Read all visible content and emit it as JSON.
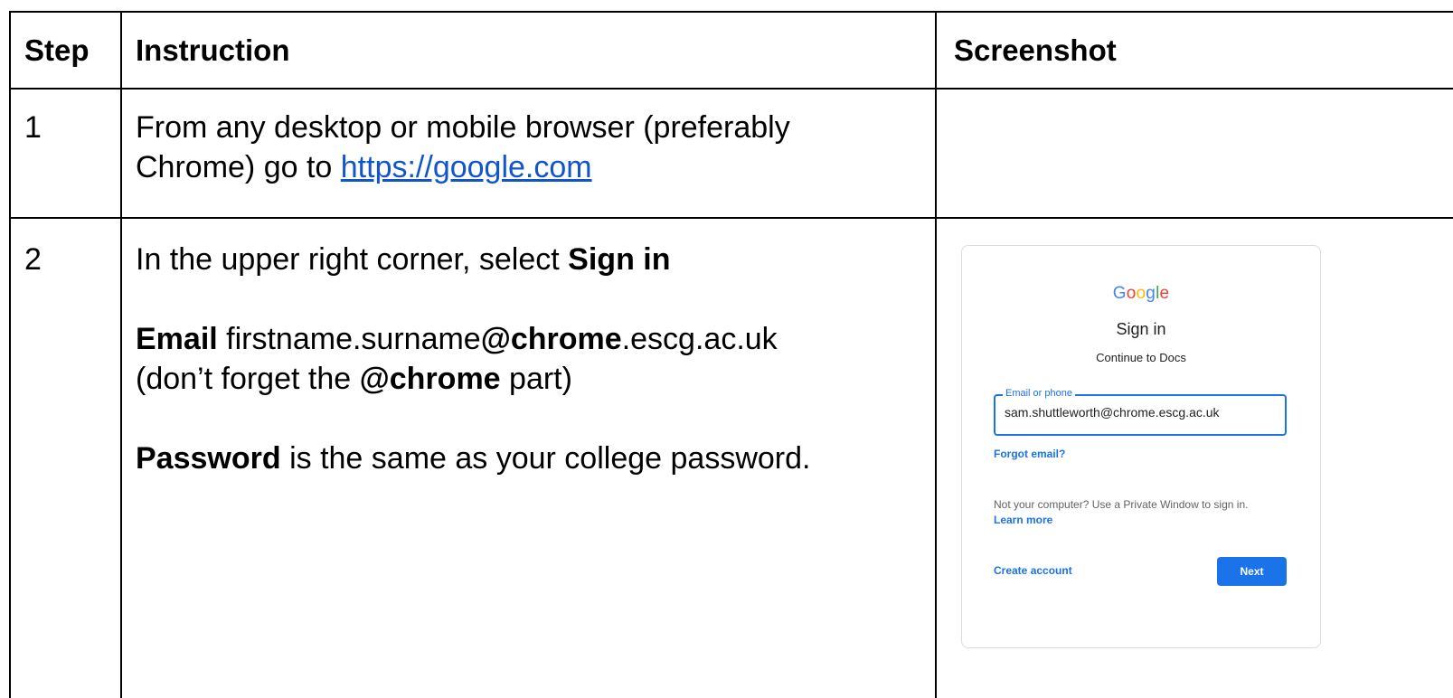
{
  "table": {
    "headers": {
      "step": "Step",
      "instruction": "Instruction",
      "screenshot": "Screenshot"
    },
    "rows": [
      {
        "step": "1",
        "line1": "From any desktop or mobile browser (preferably",
        "line2_prefix": "Chrome) go to ",
        "link": "https://google.com"
      },
      {
        "step": "2",
        "sign_prefix": "In the upper right corner, select ",
        "sign_bold": "Sign in",
        "email_bold": "Email",
        "email_part1": " firstname.surname",
        "email_bold_domain": "@chrome",
        "email_part2": ".escg.ac.uk",
        "note_prefix": "(don’t forget the ",
        "note_bold": "@chrome",
        "note_suffix": " part)",
        "password_bold": "Password",
        "password_rest": " is the same as your college password."
      }
    ]
  },
  "signin_screenshot": {
    "logo_letters": [
      {
        "ch": "G",
        "color": "#4285f4"
      },
      {
        "ch": "o",
        "color": "#ea4335"
      },
      {
        "ch": "o",
        "color": "#fbbc05"
      },
      {
        "ch": "g",
        "color": "#4285f4"
      },
      {
        "ch": "l",
        "color": "#34a853"
      },
      {
        "ch": "e",
        "color": "#ea4335"
      }
    ],
    "title": "Sign in",
    "subtitle": "Continue to Docs",
    "field_label": "Email or phone",
    "field_value": "sam.shuttleworth@chrome.escg.ac.uk",
    "forgot": "Forgot email?",
    "notice": "Not your computer? Use a Private Window to sign in.",
    "learn_more": "Learn more",
    "create_account": "Create account",
    "next": "Next",
    "accent": "#1a73e8"
  }
}
